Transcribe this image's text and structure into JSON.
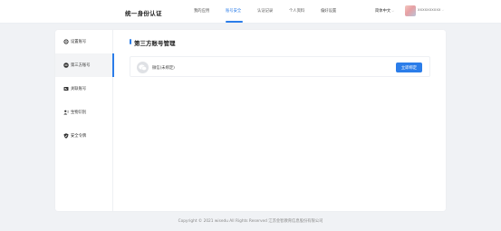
{
  "header": {
    "brand": "统一身份认证",
    "nav": [
      {
        "label": "我的应用"
      },
      {
        "label": "账号安全",
        "active": true
      },
      {
        "label": "认证记录"
      },
      {
        "label": "个人资料"
      },
      {
        "label": "偏好设置"
      }
    ],
    "language": "简体中文",
    "username": "xxxxxxxxxx"
  },
  "sidebar": {
    "items": [
      {
        "label": "设置账号",
        "icon": "gear-icon"
      },
      {
        "label": "第三方账号",
        "icon": "link-icon",
        "active": true
      },
      {
        "label": "关联账号",
        "icon": "id-card-icon"
      },
      {
        "label": "生物识别",
        "icon": "user-icon"
      },
      {
        "label": "安全令牌",
        "icon": "shield-icon"
      }
    ]
  },
  "main": {
    "title": "第三方账号管理",
    "bindings": [
      {
        "label": "微信(未绑定)",
        "icon": "wechat-icon",
        "button_label": "立即绑定"
      }
    ]
  },
  "footer": {
    "copyright": "Copyright © 2021 wisedu All Rights Reserved 江苏金智教育信息股份有限公司"
  },
  "colors": {
    "accent": "#2b7de9",
    "background": "#f0f2f5"
  }
}
